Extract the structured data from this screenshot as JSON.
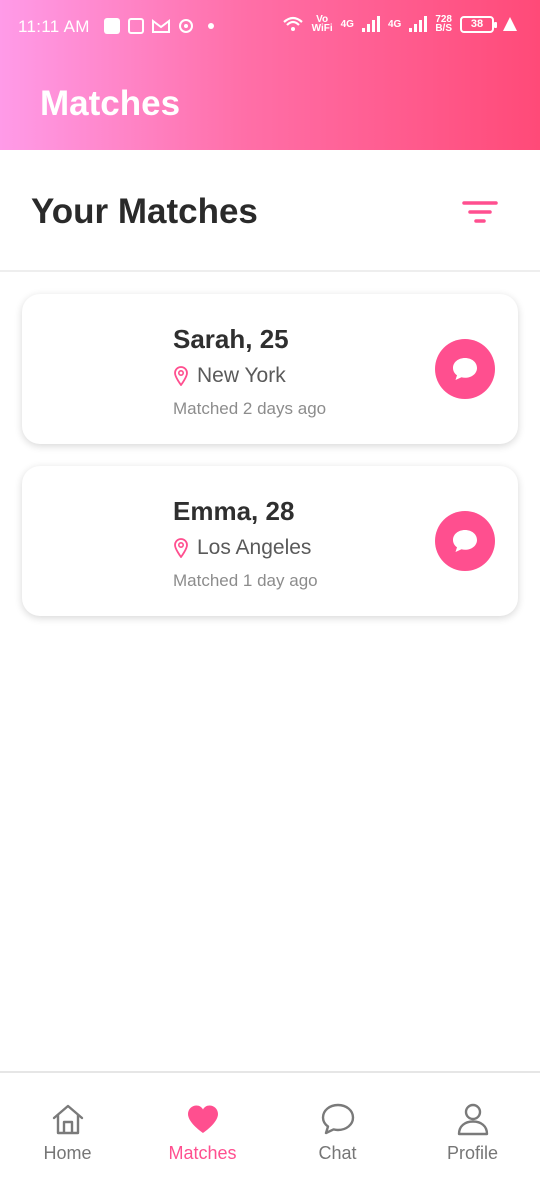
{
  "status_bar": {
    "time": "11:11 AM",
    "network_label_top": "Vo",
    "network_label_bottom": "WiFi",
    "signal1_label": "4G",
    "signal2_label": "4G",
    "speed_value": "728",
    "speed_unit": "B/S",
    "battery": "38"
  },
  "header": {
    "title": "Matches",
    "gradient_start": "#ff9be8",
    "gradient_end": "#ff4a78"
  },
  "section": {
    "title": "Your Matches",
    "filter_icon": "filter-icon"
  },
  "matches": [
    {
      "name": "Sarah, 25",
      "location": "New York",
      "matched": "Matched 2 days ago"
    },
    {
      "name": "Emma, 28",
      "location": "Los Angeles",
      "matched": "Matched 1 day ago"
    }
  ],
  "nav": {
    "items": [
      {
        "label": "Home",
        "icon": "home-icon"
      },
      {
        "label": "Matches",
        "icon": "heart-icon",
        "active": true
      },
      {
        "label": "Chat",
        "icon": "chat-icon"
      },
      {
        "label": "Profile",
        "icon": "profile-icon"
      }
    ]
  },
  "colors": {
    "accent": "#ff4f8f",
    "title_text": "#2a2a2a"
  }
}
